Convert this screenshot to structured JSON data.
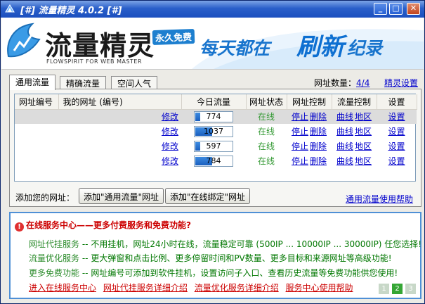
{
  "window": {
    "title": "[#] 流量精灵 4.0.2 [#]",
    "controls": {
      "minimize": "_",
      "maximize": "□",
      "close": "✕"
    }
  },
  "banner": {
    "brand": "流量精灵",
    "brand_en": "FLOWSPIRIT FOR WEB MASTER",
    "free_tag": "永久免费",
    "slogan_1": "每天都在",
    "slogan_2": "刷新",
    "slogan_3": "纪录"
  },
  "tabs": [
    {
      "label": "通用流量",
      "active": true
    },
    {
      "label": "精确流量",
      "active": false
    },
    {
      "label": "空间人气",
      "active": false
    }
  ],
  "site_count": {
    "label": "网址数量：",
    "value": "4/4"
  },
  "settings_link": "精灵设置",
  "table": {
    "headers": [
      "网址编号",
      "我的网址 (编号)",
      "今日流量",
      "网址状态",
      "网址控制",
      "流量控制",
      "设置"
    ],
    "rows": [
      {
        "edit": "修改",
        "flow": "774",
        "flow_pct": 0.13,
        "status": "在线",
        "stop": "停止",
        "delete": "删除",
        "curve": "曲线",
        "region": "地区",
        "setting": "设置",
        "selected": true
      },
      {
        "edit": "修改",
        "flow": "1037",
        "flow_pct": 0.45,
        "status": "在线",
        "stop": "停止",
        "delete": "删除",
        "curve": "曲线",
        "region": "地区",
        "setting": "设置",
        "selected": false
      },
      {
        "edit": "修改",
        "flow": "597",
        "flow_pct": 0.13,
        "status": "在线",
        "stop": "停止",
        "delete": "删除",
        "curve": "曲线",
        "region": "地区",
        "setting": "设置",
        "selected": false
      },
      {
        "edit": "修改",
        "flow": "784",
        "flow_pct": 0.45,
        "status": "在线",
        "stop": "停止",
        "delete": "删除",
        "curve": "曲线",
        "region": "地区",
        "setting": "设置",
        "selected": false
      }
    ]
  },
  "add_section": {
    "label": "添加您的网址：",
    "btn_general": "添加\"通用流量\"网址",
    "btn_bind": "添加\"在线绑定\"网址",
    "help": "通用流量使用帮助"
  },
  "service": {
    "title": "在线服务中心——更多付费服务和免费功能?",
    "lines": [
      {
        "name": "网址代挂服务",
        "text": "-- 不用挂机，网址24小时在线，流量稳定可靠 (500IP ... 10000IP ... 30000IP) 任您选择!"
      },
      {
        "name": "流量优化服务",
        "text": "-- 更大弹窗和点击比例、更多停留时间和PV数量、更多目标和来源网址等高级功能!"
      },
      {
        "name": "更多免费功能",
        "text": "-- 网址编号可添加到软件挂机，设置访问子入口、查看历史流量等免费功能供您使用!"
      }
    ],
    "links": [
      "进入在线服务中心",
      "网址代挂服务详细介绍",
      "流量优化服务详细介绍",
      "服务中心使用帮助"
    ],
    "pages": [
      "1",
      "2",
      "3"
    ]
  }
}
